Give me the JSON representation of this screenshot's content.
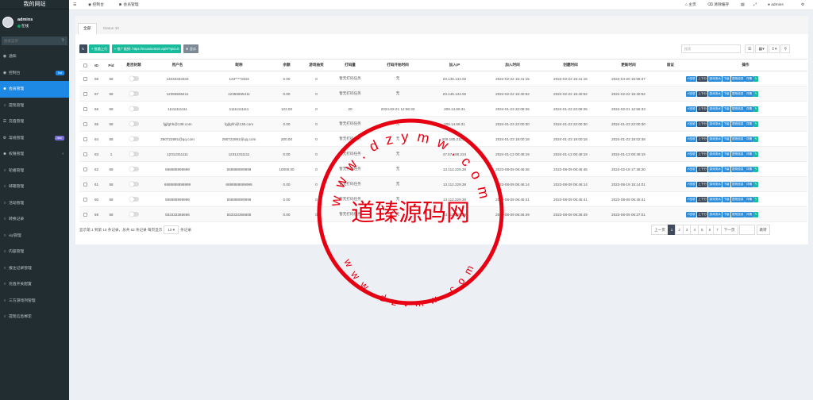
{
  "site": {
    "title": "我的网站"
  },
  "user": {
    "name": "admins",
    "status": "在线"
  },
  "sidebar_search": {
    "placeholder": "搜索菜单"
  },
  "menu": [
    {
      "label": "通知",
      "icon": "dashboard-icon",
      "badge": ""
    },
    {
      "label": "控制台",
      "icon": "dashboard-icon",
      "badge": "hot"
    },
    {
      "label": "会员管理",
      "icon": "users-icon",
      "badge": ""
    },
    {
      "label": "提现管理",
      "icon": "circle-icon",
      "badge": ""
    },
    {
      "label": "充值管理",
      "icon": "list-icon",
      "badge": ""
    },
    {
      "label": "常规管理",
      "icon": "cogs-icon",
      "badge": "new"
    },
    {
      "label": "权限管理",
      "icon": "group-icon",
      "badge": ""
    },
    {
      "label": "轮播管理",
      "icon": "circle-icon",
      "badge": ""
    },
    {
      "label": "邮箱管理",
      "icon": "circle-icon",
      "badge": ""
    },
    {
      "label": "活动管理",
      "icon": "circle-icon",
      "badge": ""
    },
    {
      "label": "转换记录",
      "icon": "circle-icon",
      "badge": ""
    },
    {
      "label": "vip管理",
      "icon": "circle-icon",
      "badge": ""
    },
    {
      "label": "内容管理",
      "icon": "circle-icon",
      "badge": ""
    },
    {
      "label": "报注记录管理",
      "icon": "circle-icon",
      "badge": ""
    },
    {
      "label": "充值开关配置",
      "icon": "circle-icon",
      "badge": ""
    },
    {
      "label": "三方游戏列管理",
      "icon": "circle-icon",
      "badge": ""
    },
    {
      "label": "提现信息绑定",
      "icon": "circle-icon",
      "badge": ""
    }
  ],
  "topbar": {
    "tab1": "控制台",
    "tab2": "会员管理",
    "home": "主页",
    "clear": "清除缓存",
    "user": "admins"
  },
  "tabs": [
    "全部",
    "Status 30"
  ],
  "toolbar": {
    "batch": "批量上行",
    "promo": "推广链接: https://mcasino618.vip/#/?pid=0",
    "display": "显示"
  },
  "search_placeholder": "搜索",
  "columns": [
    "",
    "ID",
    "Pid",
    "是否封禁",
    "用户名",
    "昵称",
    "余额",
    "游戏抽奖",
    "打码量",
    "打码开始时间",
    "加入IP",
    "加入时间",
    "创建时间",
    "更新时间",
    "验证",
    "操作"
  ],
  "rows": [
    [
      "68",
      "58",
      "13333333333",
      "133****3333",
      "0.00",
      "0",
      "暂无打码任务",
      "无",
      "23.146.144.92",
      "2024-02-22 15:41:15",
      "2024-02-22 15:41:15",
      "2024-04-20 16:58:37"
    ],
    [
      "67",
      "58",
      "12355555411",
      "12355555411",
      "0.00",
      "0",
      "暂无打码任务",
      "无",
      "23.146.144.92",
      "2024-02-22 15:40:52",
      "2024-02-22 15:40:52",
      "2024-02-22 15:40:52"
    ],
    [
      "66",
      "58",
      "11111111111",
      "11111111111",
      "122.00",
      "0",
      "20",
      "2024-02-21 12:56:33",
      "209.14.69.31",
      "2024-01-23 22:08:26",
      "2024-01-23 22:08:26",
      "2024-02-21 12:56:33"
    ],
    [
      "65",
      "58",
      "fgjfghh@136.com",
      "fgjfghh@136.com",
      "0.00",
      "0",
      "暂无打码任务",
      "无",
      "209.14.69.31",
      "2024-01-23 22:00:30",
      "2024-01-23 22:00:30",
      "2024-01-23 22:00:30"
    ],
    [
      "64",
      "58",
      "290722891@qq.com",
      "290722891@qq.com",
      "200.00",
      "0",
      "暂无打码任务",
      "无",
      "209.180.211.29",
      "2024-01-23 19:00:18",
      "2024-01-23 19:00:18",
      "2024-01-23 19:02:48"
    ],
    [
      "63",
      "1",
      "12312311111",
      "12312311111",
      "0.00",
      "0",
      "暂无打码任务",
      "无",
      "47.57.188.224",
      "2024-01-13 00:48:19",
      "2024-01-13 00:48:19",
      "2024-01-13 00:48:19"
    ],
    [
      "62",
      "58",
      "668888899999",
      "668888899999",
      "10000.00",
      "0",
      "暂无打码任务",
      "无",
      "13.112.229.38",
      "2023-08-09 06:46:46",
      "2023-08-09 06:46:46",
      "2024-02-18 17:38:20"
    ],
    [
      "61",
      "58",
      "6688888899999",
      "6688888899999",
      "0.00",
      "0",
      "暂无打码任务",
      "无",
      "13.112.229.38",
      "2023-08-09 06:46:14",
      "2023-08-09 06:46:14",
      "2023-08-19 15:14:01"
    ],
    [
      "60",
      "58",
      "558888899999",
      "558888899999",
      "0.00",
      "0",
      "暂无打码任务",
      "无",
      "13.112.229.38",
      "2023-08-09 06:45:41",
      "2023-08-09 06:45:41",
      "2023-08-09 06:45:41"
    ],
    [
      "59",
      "58",
      "553333366666",
      "553333366666",
      "0.00",
      "0",
      "暂无打码任务",
      "无",
      "13.112.229.38",
      "2023-08-09 06:36:49",
      "2023-08-09 06:36:49",
      "2023-08-09 06:37:01"
    ]
  ],
  "ops": [
    "回收",
    "上下分",
    "游戏流水",
    "下级",
    "提现信息",
    "详情",
    "编辑"
  ],
  "pager": {
    "info_pre": "显示第 1 到第 10 条记录，总共 62 条记录 每页显示",
    "per_page": "10",
    "info_post": "条记录",
    "prev": "上一页",
    "pages": [
      "1",
      "2",
      "3",
      "4",
      "5",
      "6",
      "7"
    ],
    "next": "下一页",
    "jump": "跳转"
  },
  "watermark": {
    "text": "道臻源码网",
    "url_top": "www.dzymw.com",
    "url_bottom": "www.dzymw.com"
  },
  "colors": {
    "sidebar": "#222d32",
    "accent": "#1e88e5",
    "stamp": "#e60012"
  }
}
